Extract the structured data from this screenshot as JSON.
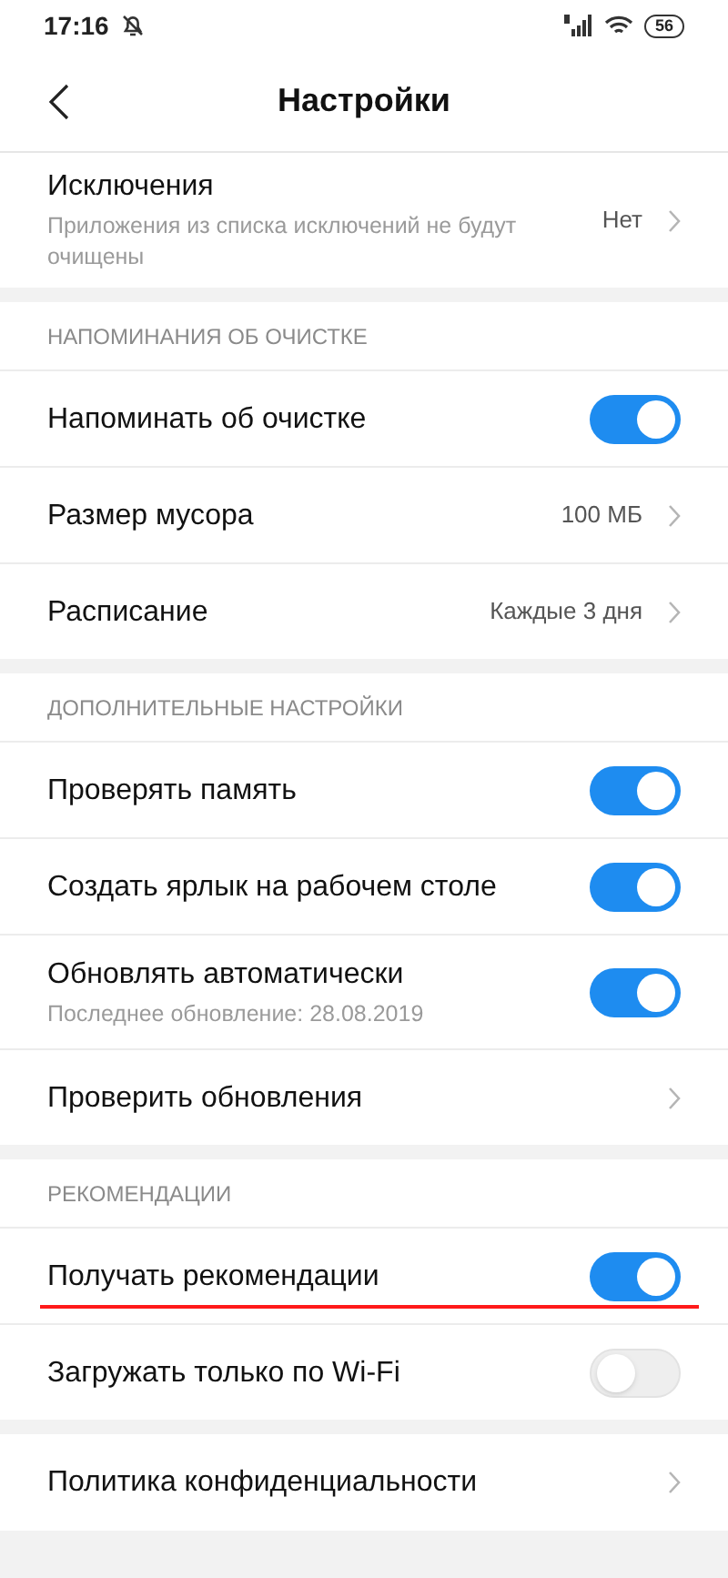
{
  "status_bar": {
    "time": "17:16",
    "battery": "56"
  },
  "header": {
    "title": "Настройки"
  },
  "groups": [
    {
      "items": [
        {
          "kind": "link",
          "label": "Исключения",
          "subtitle": "Приложения из списка исключений не будут очищены",
          "value": "Нет",
          "marked": false
        }
      ]
    },
    {
      "heading": "НАПОМИНАНИЯ ОБ ОЧИСТКЕ",
      "items": [
        {
          "kind": "toggle",
          "label": "Напоминать об очистке",
          "on": true,
          "marked": false
        },
        {
          "kind": "link",
          "label": "Размер мусора",
          "value": "100 МБ",
          "marked": false
        },
        {
          "kind": "link",
          "label": "Расписание",
          "value": "Каждые 3 дня",
          "marked": false
        }
      ]
    },
    {
      "heading": "ДОПОЛНИТЕЛЬНЫЕ НАСТРОЙКИ",
      "items": [
        {
          "kind": "toggle",
          "label": "Проверять память",
          "on": true,
          "marked": false
        },
        {
          "kind": "toggle",
          "label": "Создать ярлык на рабочем столе",
          "on": true,
          "marked": false
        },
        {
          "kind": "toggle",
          "label": "Обновлять автоматически",
          "subtitle": "Последнее обновление: 28.08.2019",
          "on": true,
          "marked": false
        },
        {
          "kind": "link",
          "label": "Проверить обновления",
          "marked": false
        }
      ]
    },
    {
      "heading": "РЕКОМЕНДАЦИИ",
      "items": [
        {
          "kind": "toggle",
          "label": "Получать рекомендации",
          "on": true,
          "marked": true
        },
        {
          "kind": "toggle",
          "label": "Загружать только по Wi-Fi",
          "on": false,
          "marked": false
        }
      ]
    },
    {
      "items": [
        {
          "kind": "link",
          "label": "Политика конфиденциальности",
          "marked": false
        }
      ]
    }
  ]
}
